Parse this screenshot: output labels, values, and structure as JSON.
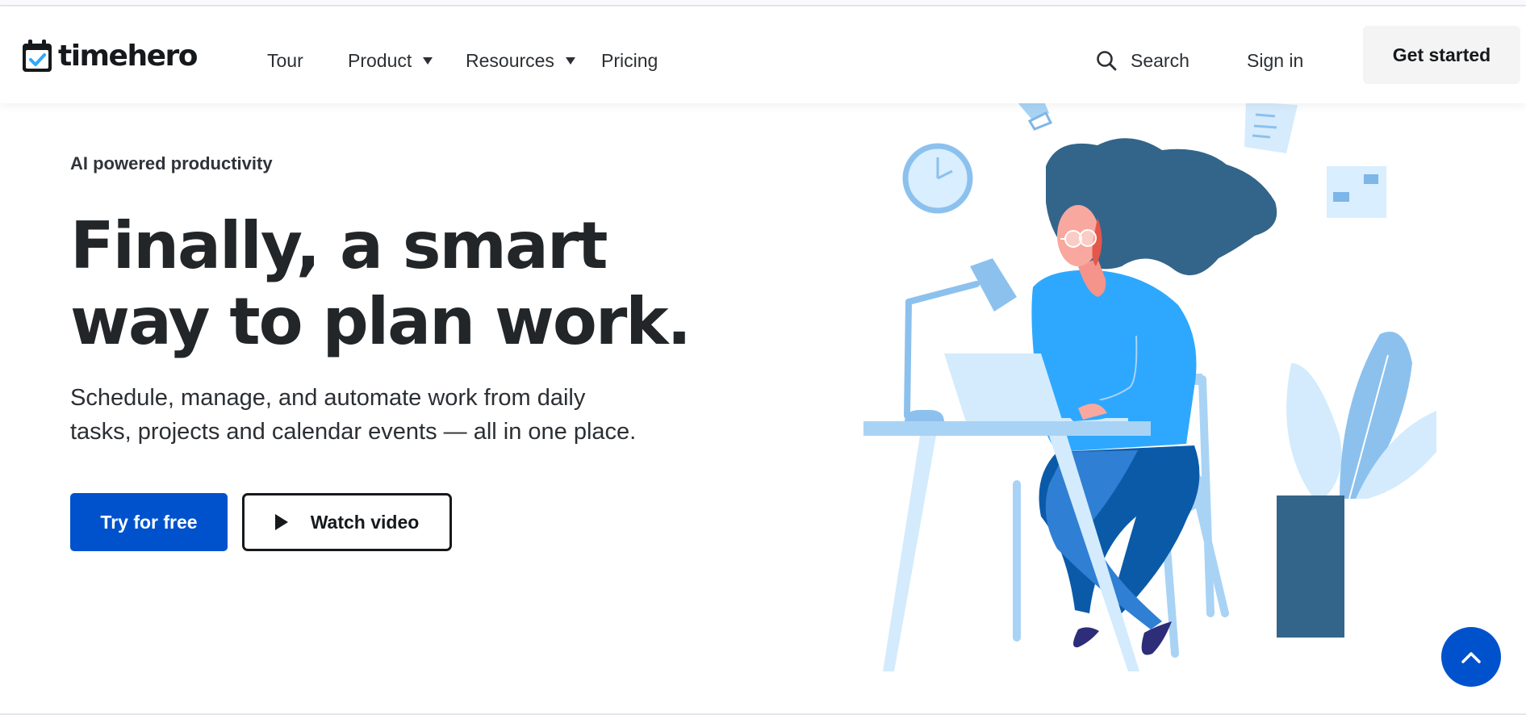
{
  "nav": {
    "brand": "timehero",
    "links": {
      "tour": "Tour",
      "product": "Product",
      "resources": "Resources",
      "pricing": "Pricing"
    },
    "search_label": "Search",
    "sign_in": "Sign in",
    "get_started": "Get started"
  },
  "hero": {
    "eyebrow": "AI powered productivity",
    "headline_line1": "Finally, a smart",
    "headline_line2": "way to plan work.",
    "subtitle_line1": "Schedule, manage, and automate work from daily",
    "subtitle_line2": "tasks, projects and calendar events — all in one place.",
    "primary_cta": "Try for free",
    "secondary_cta": "Watch video"
  },
  "icons": {
    "logo": "calendar-check-icon",
    "search": "search-icon",
    "dropdown": "caret-down-icon",
    "play": "play-icon",
    "scroll_top": "chevron-up-icon"
  },
  "colors": {
    "brand_blue": "#0052cc",
    "text_dark": "#222629",
    "button_light": "#f4f4f4",
    "illustration_blue": "#2ea8ff",
    "illustration_navy": "#33658a"
  }
}
